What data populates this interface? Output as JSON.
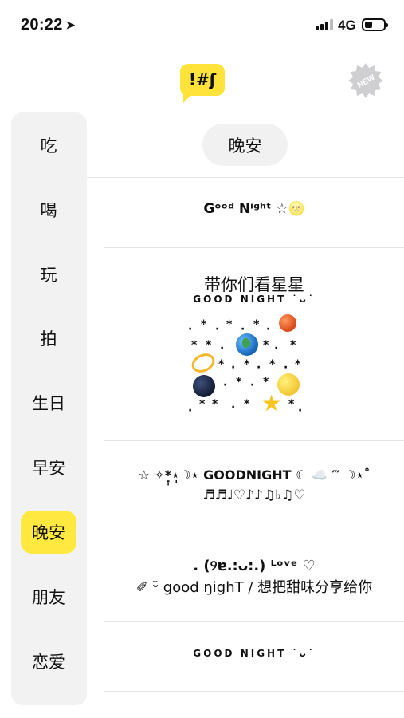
{
  "status_bar": {
    "time": "20:22",
    "location_icon": "location-arrow-icon",
    "network": "4G"
  },
  "header": {
    "logo_text": "!#ʃ",
    "badge_text": "NEW"
  },
  "sidebar": {
    "items": [
      {
        "label": "吃",
        "active": false
      },
      {
        "label": "喝",
        "active": false
      },
      {
        "label": "玩",
        "active": false
      },
      {
        "label": "拍",
        "active": false
      },
      {
        "label": "生日",
        "active": false
      },
      {
        "label": "早安",
        "active": false
      },
      {
        "label": "晚安",
        "active": true
      },
      {
        "label": "朋友",
        "active": false
      },
      {
        "label": "恋爱",
        "active": false
      }
    ],
    "active_color": "#ffe83f"
  },
  "main": {
    "category": "晚安",
    "cards": [
      {
        "lines": [
          "Gᵒᵒᵈ Nⁱᵍʰᵗ ☆🌝"
        ]
      },
      {
        "lines": [
          "带你们看星星",
          "GOOD NIGHT ˙ᴗ˙"
        ],
        "art": "starry-sky-emoji-art"
      },
      {
        "lines": [
          "☆ ✧*̣̩⋆̩☽⋆ GOODNIGHT ☾ ☁️ ‴ ☽⋆˚",
          "♬♬♩♡♪♪♫♭♫♡"
        ]
      },
      {
        "lines": [
          ". (୨ɐ.:ᴗ:.) ᴸᵒᵛᵉ ♡",
          "✐ ᵕ̈ good ŋighT / 想把甜味分享给你"
        ]
      },
      {
        "lines": [
          "GOOD NIGHT ˙ᴗ˙"
        ]
      }
    ]
  }
}
